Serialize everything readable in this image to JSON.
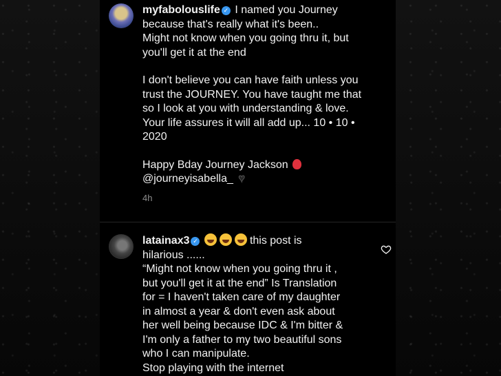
{
  "comments": [
    {
      "username": "myfabolouslife",
      "text_first": "I named you Journey",
      "lines": [
        "because that's really what it's been..",
        "Might not know when you going thru it, but",
        "you'll get it at the end"
      ],
      "paragraph2": "I don't believe you can have faith unless you\ntrust the JOURNEY.  You have taught me that\nso I look at you with understanding & love.\nYour life assures it will all add up... 10 • 10 •\n2020",
      "paragraph3_line1": "Happy Bday Journey Jackson",
      "paragraph3_line2": "@journeyisabella_",
      "time": "4h"
    },
    {
      "username": "latainax3",
      "text_first": "this post is",
      "body": "hilarious ......\n“Might not know when you going thru it ,\nbut you'll get it at the end” Is Translation\nfor = I haven't taken care of my daughter\nin almost a year & don't even ask about\nher well being because IDC & I'm bitter &\nI'm only a father to my two beautiful sons\nwho I can manipulate.\nStop playing with the internet"
    }
  ],
  "icons": {
    "verified": "verified-badge-icon",
    "like": "heart-outline-icon",
    "balloon": "red-balloon-emoji",
    "black_heart": "black-heart-emoji",
    "laugh": "tears-of-joy-emoji"
  },
  "colors": {
    "background": "#000000",
    "text": "#f2f2f2",
    "muted": "#8e8e8e",
    "verified": "#3897f0"
  }
}
